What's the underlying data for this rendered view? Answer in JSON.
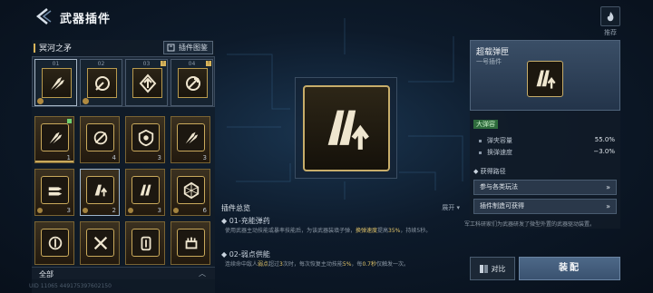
{
  "header": {
    "title": "武器插件",
    "info_icon": "i"
  },
  "recommend": {
    "label": "推荐",
    "icon": "flame-icon"
  },
  "weapon": {
    "name": "冥河之矛"
  },
  "atlas": {
    "label": "插件图鉴"
  },
  "equip_slots": [
    {
      "num": "01",
      "flag": ""
    },
    {
      "num": "02",
      "flag": ""
    },
    {
      "num": "03",
      "flag": "!"
    },
    {
      "num": "04",
      "flag": "!"
    }
  ],
  "plugin_grid": [
    {
      "count": "1",
      "new": true
    },
    {
      "count": "4",
      "new": false
    },
    {
      "count": "3",
      "new": false
    },
    {
      "count": "3",
      "new": false
    },
    {
      "count": "3",
      "new": false
    },
    {
      "count": "2",
      "new": false
    },
    {
      "count": "3",
      "new": false
    },
    {
      "count": "6",
      "new": false
    },
    {
      "count": "",
      "new": false
    },
    {
      "count": "",
      "new": false
    },
    {
      "count": "",
      "new": false
    },
    {
      "count": "",
      "new": false
    }
  ],
  "filter": {
    "label": "全部"
  },
  "uid": "UID  11065  449175397602150",
  "summary": {
    "title": "插件总览",
    "expand": "展开",
    "s1_title": "01-充能弹药",
    "s1_desc_a": "使用武器主动技能或暴率技能后，为该武器装填子弹，",
    "s1_hl1": "换弹速度",
    "s1_desc_b": "提高",
    "s1_hl2": "35%",
    "s1_desc_c": "，持续5秒。",
    "s2_title": "02-弱点供能",
    "s2_desc_a": "连续命中敌人",
    "s2_hl1": "弱点",
    "s2_desc_b": "超过",
    "s2_hl2": "3",
    "s2_desc_c": "次时，每次恢复主动技能",
    "s2_hl3": "5%",
    "s2_desc_d": "，每",
    "s2_hl4": "0.7秒",
    "s2_desc_e": "仅触发一次。"
  },
  "detail": {
    "name": "超载弹匣",
    "sub": "一号插件",
    "tag": "大弹容",
    "stats": [
      {
        "label": "弹夹容量",
        "value": "55.0%"
      },
      {
        "label": "换弹速度",
        "value": "−3.0%"
      }
    ],
    "route_title": "获得路径",
    "routes": [
      {
        "label": "参与各类玩法"
      },
      {
        "label": "插件制造可获得"
      }
    ],
    "desc": "军工科研家们为武器研发了微型外置的武器驱动装置。"
  },
  "actions": {
    "compare": "对比",
    "equip": "装配"
  },
  "colors": {
    "gold": "#c9a95b",
    "accent": "#4d6888"
  }
}
